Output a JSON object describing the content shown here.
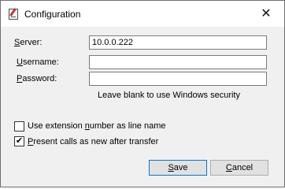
{
  "window": {
    "title": "Configuration",
    "close_symbol": "✕"
  },
  "form": {
    "server": {
      "label": "Server:",
      "value": "10.0.0.222"
    },
    "username": {
      "label": "Username:",
      "value": ""
    },
    "password": {
      "label": "Password:",
      "value": ""
    },
    "hint": "Leave blank to use Windows security"
  },
  "options": [
    {
      "label": "Use extension number as line name",
      "checked": false
    },
    {
      "label": "Present calls as new after transfer",
      "checked": true
    }
  ],
  "buttons": {
    "save": "Save",
    "cancel": "Cancel"
  },
  "icons": {
    "app": "configuration-app-icon",
    "close": "close-icon",
    "check": "checkmark-icon"
  }
}
